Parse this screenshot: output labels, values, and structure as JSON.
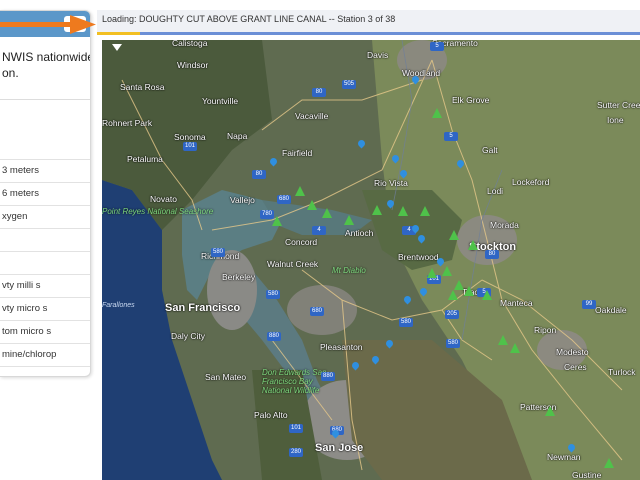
{
  "panel": {
    "description_line1": "NWIS nationwide",
    "description_line2": "on.",
    "parameters": [
      "3 meters",
      "6 meters",
      "xygen",
      "",
      "",
      "vty milli s",
      "vty micro s",
      "tom micro s",
      "mine/chlorop"
    ]
  },
  "loading": {
    "text": "Loading: DOUGHTY CUT ABOVE GRANT LINE CANAL -- Station 3 of 38",
    "current": 3,
    "total": 38
  },
  "map": {
    "cities": [
      {
        "name": "Santa Rosa",
        "big": false
      },
      {
        "name": "Calistoga",
        "big": false
      },
      {
        "name": "Windsor",
        "big": false
      },
      {
        "name": "Woodland",
        "big": false
      },
      {
        "name": "Davis",
        "big": false
      },
      {
        "name": "Sacramento",
        "big": false
      },
      {
        "name": "Elk Grove",
        "big": false
      },
      {
        "name": "Sutter Creek",
        "big": false
      },
      {
        "name": "Ione",
        "big": false
      },
      {
        "name": "Yountville",
        "big": false
      },
      {
        "name": "Vacaville",
        "big": false
      },
      {
        "name": "Rohnert Park",
        "big": false
      },
      {
        "name": "Sonoma",
        "big": false
      },
      {
        "name": "Napa",
        "big": false
      },
      {
        "name": "Galt",
        "big": false
      },
      {
        "name": "Fairfield",
        "big": false
      },
      {
        "name": "Rio Vista",
        "big": false
      },
      {
        "name": "Petaluma",
        "big": false
      },
      {
        "name": "Lodi",
        "big": false
      },
      {
        "name": "Lockeford",
        "big": false
      },
      {
        "name": "Novato",
        "big": false
      },
      {
        "name": "Vallejo",
        "big": false
      },
      {
        "name": "Point Reyes National Seashore",
        "big": false
      },
      {
        "name": "Concord",
        "big": false
      },
      {
        "name": "Antioch",
        "big": false
      },
      {
        "name": "Morada",
        "big": false
      },
      {
        "name": "Richmond",
        "big": false
      },
      {
        "name": "Walnut Creek",
        "big": false
      },
      {
        "name": "Mt Diablo",
        "big": false
      },
      {
        "name": "Brentwood",
        "big": false
      },
      {
        "name": "Stockton",
        "big": false
      },
      {
        "name": "Berkeley",
        "big": false
      },
      {
        "name": "Tracy",
        "big": false
      },
      {
        "name": "Manteca",
        "big": false
      },
      {
        "name": "San Francisco",
        "big": true
      },
      {
        "name": "Oakdale",
        "big": false
      },
      {
        "name": "Daly City",
        "big": false
      },
      {
        "name": "Pleasanton",
        "big": false
      },
      {
        "name": "Ripon",
        "big": false
      },
      {
        "name": "Modesto",
        "big": false
      },
      {
        "name": "Ceres",
        "big": false
      },
      {
        "name": "San Mateo",
        "big": false
      },
      {
        "name": "Don Edwards San Francisco Bay National Wildlife",
        "big": false
      },
      {
        "name": "Turlock",
        "big": false
      },
      {
        "name": "Palo Alto",
        "big": false
      },
      {
        "name": "Patterson",
        "big": false
      },
      {
        "name": "San Jose",
        "big": true
      },
      {
        "name": "Newman",
        "big": false
      },
      {
        "name": "Gustine",
        "big": false
      }
    ],
    "ocean_label": "Farallones",
    "shields": [
      "5",
      "80",
      "505",
      "80",
      "5",
      "780",
      "680",
      "580",
      "4",
      "4",
      "580",
      "680",
      "580",
      "205",
      "5",
      "80",
      "880",
      "580",
      "101",
      "99",
      "880",
      "280",
      "101",
      "680",
      "101"
    ]
  },
  "colors": {
    "panel_header": "#5b97c9",
    "arrow": "#ee7a1e",
    "progress": "#f2bf22",
    "progress_track": "#6b8fd6",
    "marker_drop": "#2f8fe0",
    "marker_leaf": "#4fc24a"
  },
  "icons": {
    "panel_toggle": "panel-toggle-icon",
    "arrow": "orange-arrow-icon",
    "map_expand": "chevron-down-icon",
    "water_station": "water-drop-icon",
    "veg_station": "leaf-icon"
  }
}
